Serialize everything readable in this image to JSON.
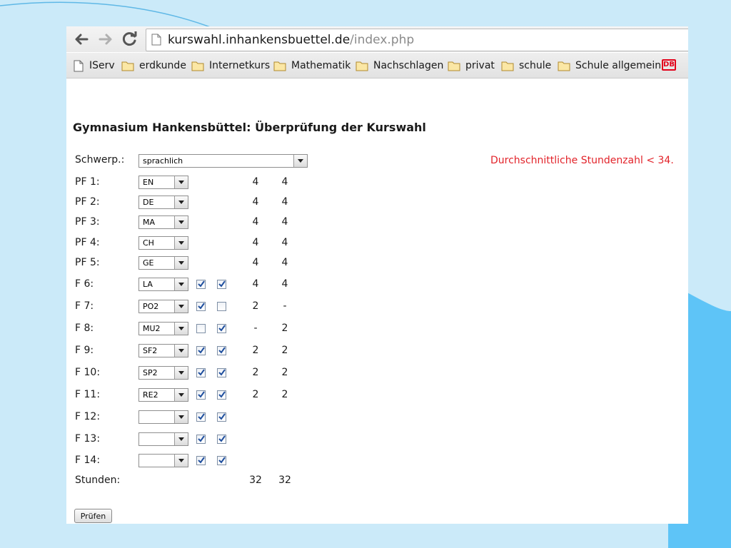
{
  "browser": {
    "url_domain": "kurswahl.inhankensbuettel.de",
    "url_path": "/index.php"
  },
  "bookmarks": [
    {
      "label": "IServ",
      "icon": "page-icon"
    },
    {
      "label": "erdkunde",
      "icon": "folder-icon"
    },
    {
      "label": "Internetkurs",
      "icon": "folder-icon"
    },
    {
      "label": "Mathematik",
      "icon": "folder-icon"
    },
    {
      "label": "Nachschlagen",
      "icon": "folder-icon"
    },
    {
      "label": "privat",
      "icon": "folder-icon"
    },
    {
      "label": "schule",
      "icon": "folder-icon"
    },
    {
      "label": "Schule allgemein",
      "icon": "folder-icon"
    },
    {
      "label": "DB",
      "icon": "db-logo"
    }
  ],
  "page": {
    "title": "Gymnasium Hankensbüttel: Überprüfung der Kurswahl",
    "schwerp_label": "Schwerp.:",
    "schwerp_value": "sprachlich",
    "warning": "Durchschnittliche Stundenzahl < 34.",
    "rows": [
      {
        "label": "PF 1:",
        "value": "EN",
        "checks": null,
        "h1": "4",
        "h2": "4"
      },
      {
        "label": "PF 2:",
        "value": "DE",
        "checks": null,
        "h1": "4",
        "h2": "4"
      },
      {
        "label": "PF 3:",
        "value": "MA",
        "checks": null,
        "h1": "4",
        "h2": "4"
      },
      {
        "label": "PF 4:",
        "value": "CH",
        "checks": null,
        "h1": "4",
        "h2": "4"
      },
      {
        "label": "PF 5:",
        "value": "GE",
        "checks": null,
        "h1": "4",
        "h2": "4"
      },
      {
        "label": "F 6:",
        "value": "LA",
        "checks": [
          true,
          true
        ],
        "h1": "4",
        "h2": "4"
      },
      {
        "label": "F 7:",
        "value": "PO2",
        "checks": [
          true,
          false
        ],
        "h1": "2",
        "h2": "-"
      },
      {
        "label": "F 8:",
        "value": "MU2",
        "checks": [
          false,
          true
        ],
        "h1": "-",
        "h2": "2"
      },
      {
        "label": "F 9:",
        "value": "SF2",
        "checks": [
          true,
          true
        ],
        "h1": "2",
        "h2": "2"
      },
      {
        "label": "F 10:",
        "value": "SP2",
        "checks": [
          true,
          true
        ],
        "h1": "2",
        "h2": "2"
      },
      {
        "label": "F 11:",
        "value": "RE2",
        "checks": [
          true,
          true
        ],
        "h1": "2",
        "h2": "2"
      },
      {
        "label": "F 12:",
        "value": "",
        "checks": [
          true,
          true
        ],
        "h1": "",
        "h2": ""
      },
      {
        "label": "F 13:",
        "value": "",
        "checks": [
          true,
          true
        ],
        "h1": "",
        "h2": ""
      },
      {
        "label": "F 14:",
        "value": "",
        "checks": [
          true,
          true
        ],
        "h1": "",
        "h2": ""
      }
    ],
    "total_label": "Stunden:",
    "total_h1": "32",
    "total_h2": "32",
    "submit_label": "Prüfen"
  },
  "colors": {
    "background": "#cbeaf9",
    "accent_blue": "#5ec4f7",
    "warning": "#e2232a",
    "checkmark": "#1f4f9e"
  }
}
